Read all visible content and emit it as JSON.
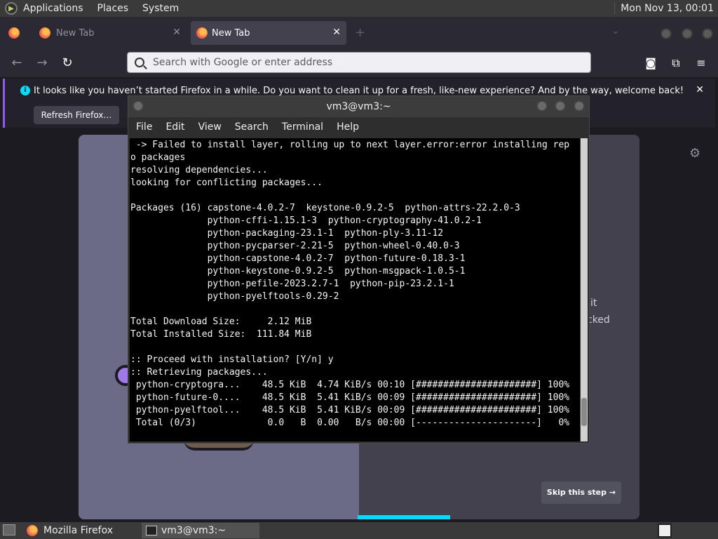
{
  "top_panel": {
    "menus": [
      "Applications",
      "Places",
      "System"
    ],
    "clock": "Mon Nov 13, 00:01"
  },
  "firefox": {
    "tabs": [
      {
        "label": "New Tab",
        "active": false
      },
      {
        "label": "New Tab",
        "active": true
      }
    ],
    "urlbar_placeholder": "Search with Google or enter address",
    "notification": {
      "message": "It looks like you haven’t started Firefox in a while. Do you want to clean it up for a fresh, like-new experience? And by the way, welcome back!",
      "button": "Refresh Firefox…"
    },
    "page": {
      "partial_text_1": "it",
      "partial_text_2": "cked",
      "skip_button": "Skip this step →"
    }
  },
  "terminal": {
    "title": "vm3@vm3:~",
    "menu": [
      "File",
      "Edit",
      "View",
      "Search",
      "Terminal",
      "Help"
    ],
    "output": " -> Failed to install layer, rolling up to next layer.error:error installing rep\no packages\nresolving dependencies...\nlooking for conflicting packages...\n\nPackages (16) capstone-4.0.2-7  keystone-0.9.2-5  python-attrs-22.2.0-3\n              python-cffi-1.15.1-3  python-cryptography-41.0.2-1\n              python-packaging-23.1-1  python-ply-3.11-12\n              python-pycparser-2.21-5  python-wheel-0.40.0-3\n              python-capstone-4.0.2-7  python-future-0.18.3-1\n              python-keystone-0.9.2-5  python-msgpack-1.0.5-1\n              python-pefile-2023.2.7-1  python-pip-23.2.1-1\n              python-pyelftools-0.29-2\n\nTotal Download Size:     2.12 MiB\nTotal Installed Size:  111.84 MiB\n\n:: Proceed with installation? [Y/n] y\n:: Retrieving packages...\n python-cryptogra...    48.5 KiB  4.74 KiB/s 00:10 [######################] 100%\n python-future-0....    48.5 KiB  5.41 KiB/s 00:09 [######################] 100%\n python-pyelftool...    48.5 KiB  5.41 KiB/s 00:09 [######################] 100%\n Total (0/3)             0.0   B  0.00   B/s 00:00 [----------------------]   0%"
  },
  "taskbar": {
    "items": [
      "Mozilla Firefox",
      "vm3@vm3:~"
    ]
  },
  "colors": {
    "firefox_bg": "#1c1b22",
    "accent": "#00ddff",
    "notification_border": "#9059ff"
  }
}
